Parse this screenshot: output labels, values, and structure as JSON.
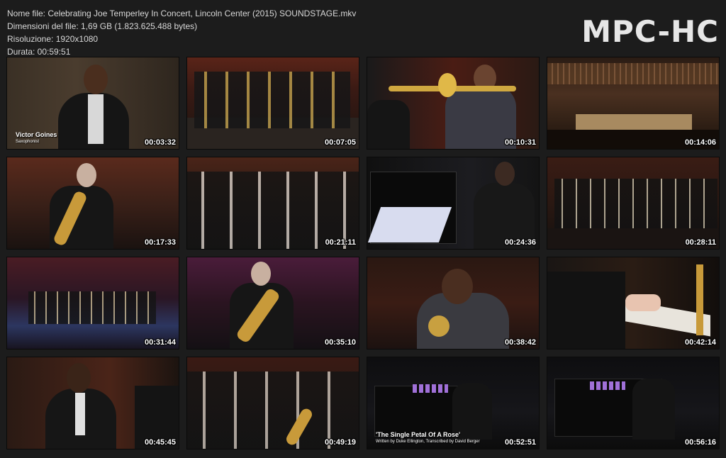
{
  "info": {
    "filename": "Nome file: Celebrating Joe Temperley In Concert, Lincoln Center (2015) SOUNDSTAGE.mkv",
    "size": "Dimensioni del file: 1,69 GB (1.823.625.488 bytes)",
    "resolution": "Risoluzione: 1920x1080",
    "duration": "Durata: 00:59:51"
  },
  "brand": "MPC-HC",
  "thumbs": [
    {
      "time": "00:03:32",
      "caption": "Victor Goines",
      "subcaption": "Saxophonist"
    },
    {
      "time": "00:07:05"
    },
    {
      "time": "00:10:31"
    },
    {
      "time": "00:14:06"
    },
    {
      "time": "00:17:33"
    },
    {
      "time": "00:21:11"
    },
    {
      "time": "00:24:36"
    },
    {
      "time": "00:28:11"
    },
    {
      "time": "00:31:44"
    },
    {
      "time": "00:35:10"
    },
    {
      "time": "00:38:42"
    },
    {
      "time": "00:42:14"
    },
    {
      "time": "00:45:45"
    },
    {
      "time": "00:49:19"
    },
    {
      "time": "00:52:51",
      "caption": "'The Single Petal Of A Rose'",
      "subcaption": "Written by Duke Ellington, Transcribed by David Berger"
    },
    {
      "time": "00:56:16"
    }
  ]
}
